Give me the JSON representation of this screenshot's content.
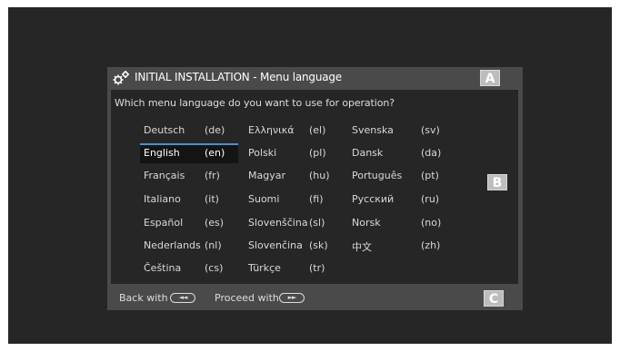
{
  "window": {
    "title": "INITIAL INSTALLATION - Menu language",
    "question": "Which menu language do you want to use for operation?"
  },
  "markers": {
    "a": "A",
    "b": "B",
    "c": "C"
  },
  "languages": [
    {
      "name": "Deutsch",
      "code": "(de)"
    },
    {
      "name": "English",
      "code": "(en)"
    },
    {
      "name": "Français",
      "code": "(fr)"
    },
    {
      "name": "Italiano",
      "code": "(it)"
    },
    {
      "name": "Español",
      "code": "(es)"
    },
    {
      "name": "Nederlands",
      "code": "(nl)"
    },
    {
      "name": "Čeština",
      "code": "(cs)"
    },
    {
      "name": "Ελληνικά",
      "code": "(el)"
    },
    {
      "name": "Polski",
      "code": "(pl)"
    },
    {
      "name": "Magyar",
      "code": "(hu)"
    },
    {
      "name": "Suomi",
      "code": "(fi)"
    },
    {
      "name": "Slovenščina",
      "code": "(sl)"
    },
    {
      "name": "Slovenčina",
      "code": "(sk)"
    },
    {
      "name": "Türkçe",
      "code": "(tr)"
    },
    {
      "name": "Svenska",
      "code": "(sv)"
    },
    {
      "name": "Dansk",
      "code": "(da)"
    },
    {
      "name": "Português",
      "code": "(pt)"
    },
    {
      "name": "Русский",
      "code": "(ru)"
    },
    {
      "name": "Norsk",
      "code": "(no)"
    },
    {
      "name": "中文",
      "code": "(zh)"
    }
  ],
  "selected_language": "English",
  "footer": {
    "back_label": "Back with",
    "back_key": "◄◄",
    "proceed_label": "Proceed with",
    "proceed_key": "►►"
  },
  "colors": {
    "accent": "#4a8fd8",
    "panel": "#4a4a4a",
    "background": "#262626"
  },
  "icons": {
    "title": "gear-icon"
  }
}
